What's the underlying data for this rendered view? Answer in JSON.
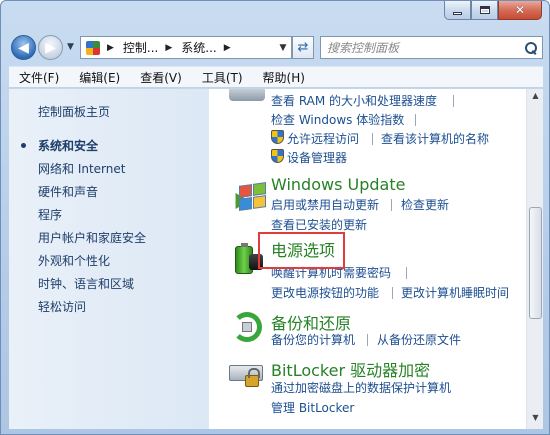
{
  "nav": {
    "back_symbol": "◀",
    "forward_symbol": "▶",
    "address_crumbs": [
      "控制...",
      "系统..."
    ],
    "search_placeholder": "搜索控制面板"
  },
  "menu": [
    "文件(F)",
    "编辑(E)",
    "查看(V)",
    "工具(T)",
    "帮助(H)"
  ],
  "sidebar": {
    "home": "控制面板主页",
    "items": [
      {
        "label": "系统和安全",
        "active": true
      },
      {
        "label": "网络和 Internet",
        "active": false
      },
      {
        "label": "硬件和声音",
        "active": false
      },
      {
        "label": "程序",
        "active": false
      },
      {
        "label": "用户帐户和家庭安全",
        "active": false
      },
      {
        "label": "外观和个性化",
        "active": false
      },
      {
        "label": "时钟、语言和区域",
        "active": false
      },
      {
        "label": "轻松访问",
        "active": false
      }
    ]
  },
  "content": {
    "system": {
      "link1": "查看 RAM 的大小和处理器速度",
      "link2": "检查 Windows 体验指数",
      "link3": "允许远程访问",
      "link4": "查看该计算机的名称",
      "link5": "设备管理器"
    },
    "windows_update": {
      "title": "Windows Update",
      "link1": "启用或禁用自动更新",
      "link2": "检查更新",
      "link3": "查看已安装的更新"
    },
    "power": {
      "title": "电源选项",
      "link1": "唤醒计算机时需要密码",
      "link2": "更改电源按钮的功能",
      "link3": "更改计算机睡眠时间"
    },
    "backup": {
      "title": "备份和还原",
      "link1": "备份您的计算机",
      "link2": "从备份还原文件"
    },
    "bitlocker": {
      "title": "BitLocker 驱动器加密",
      "link1": "通过加密磁盘上的数据保护计算机",
      "link2": "管理 BitLocker"
    }
  },
  "colors": {
    "link": "#1c4f91",
    "section_title": "#278227",
    "highlight_border": "#e23b3b"
  }
}
